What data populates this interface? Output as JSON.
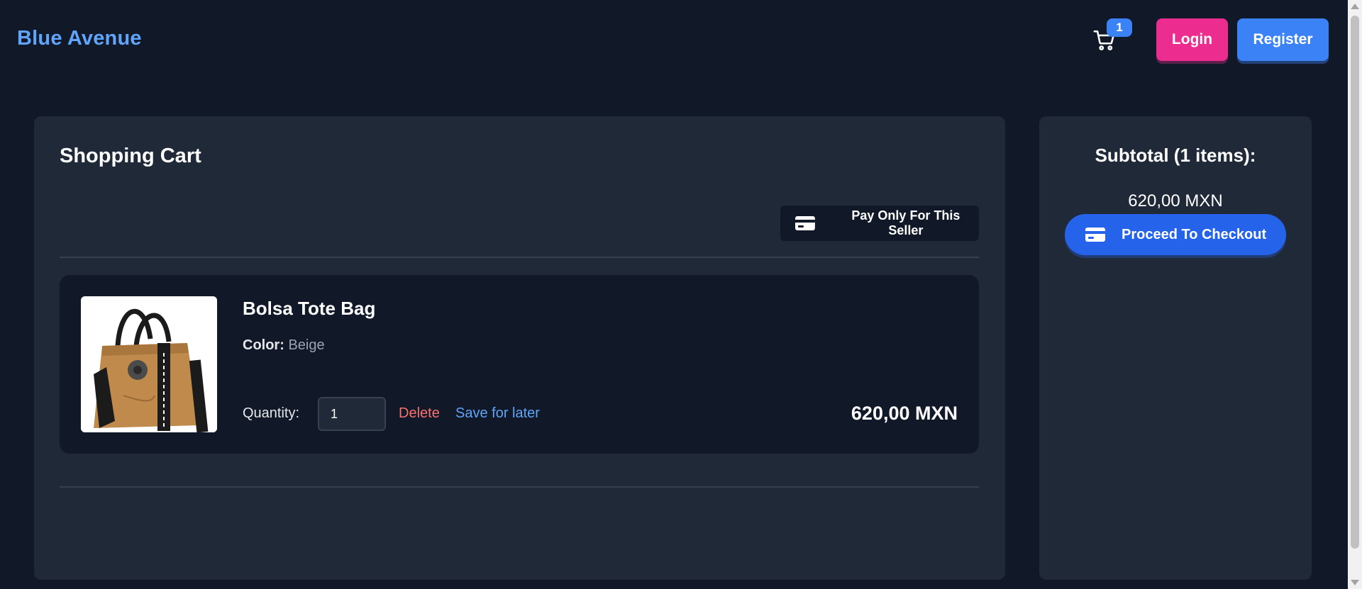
{
  "header": {
    "brand": "Blue Avenue",
    "cart_count": "1",
    "login_label": "Login",
    "register_label": "Register"
  },
  "cart": {
    "title": "Shopping Cart",
    "pay_seller_label": "Pay Only For This Seller",
    "items": [
      {
        "name": "Bolsa Tote Bag",
        "color_label": "Color:",
        "color_value": "Beige",
        "quantity_label": "Quantity:",
        "quantity": "1",
        "delete_label": "Delete",
        "save_label": "Save for later",
        "price": "620,00 MXN"
      }
    ]
  },
  "summary": {
    "subtotal_title": "Subtotal (1 items):",
    "subtotal_amount": "620,00 MXN",
    "checkout_label": "Proceed To Checkout"
  },
  "colors": {
    "background": "#111827",
    "panel": "#1f2937",
    "brand": "#60a5fa",
    "login": "#ec2d8f",
    "register": "#3b82f6",
    "checkout": "#2563eb",
    "delete": "#f87171"
  },
  "icons": {
    "cart": "shopping-cart-icon",
    "card": "credit-card-icon"
  }
}
